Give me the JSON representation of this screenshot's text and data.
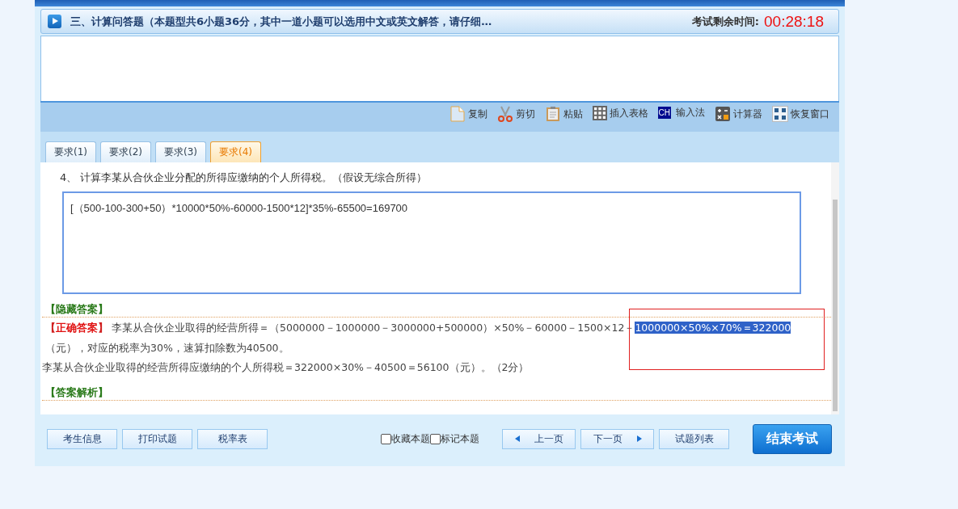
{
  "header": {
    "title": "三、计算问答题（本题型共6小题36分，其中一道小题可以选用中文或英文解答，请仔细…",
    "timer_label": "考试剩余时间:",
    "timer": "00:28:18"
  },
  "toolbar": [
    {
      "kind": "copy",
      "label": "复制"
    },
    {
      "kind": "cut",
      "label": "剪切"
    },
    {
      "kind": "paste",
      "label": "粘贴"
    },
    {
      "kind": "table",
      "label": "插入表格"
    },
    {
      "kind": "ime",
      "label": "输入法",
      "icon_text": "CH"
    },
    {
      "kind": "calc",
      "label": "计算器"
    },
    {
      "kind": "restore",
      "label": "恢复窗口"
    }
  ],
  "tabs": [
    {
      "label": "要求(1)",
      "selected": false
    },
    {
      "label": "要求(2)",
      "selected": false
    },
    {
      "label": "要求(3)",
      "selected": false
    },
    {
      "label": "要求(4)",
      "selected": true
    }
  ],
  "question": "4、 计算李某从合伙企业分配的所得应缴纳的个人所得税。（假设无综合所得）",
  "answer_value": "[（500-100-300+50）*10000*50%-60000-1500*12]*35%-65500=169700",
  "hidden_answer_label": "【隐藏答案】",
  "correct_answer": {
    "label_open": "【",
    "label": "正确答案",
    "label_close": "】",
    "text": " 李某从合伙企业取得的经营所得＝（5000000－1000000－3000000+500000）×50%－60000－1500×12－",
    "selection": "1000000×50%×70%＝322000",
    "text_after": "（元），对应的税率为30%，速算扣除数为40500。"
  },
  "answer_line_2": "李某从合伙企业取得的经营所得应缴纳的个人所得税＝322000×30%－40500＝56100（元）。（2分）",
  "analysis_label": "【答案解析】",
  "footer": {
    "left_buttons": [
      "考生信息",
      "打印试题",
      "税率表"
    ],
    "checkboxes": [
      {
        "label": "收藏本题",
        "checked": false
      },
      {
        "label": "标记本题",
        "checked": false
      }
    ],
    "prev": "上一页",
    "next": "下一页",
    "list": "试题列表",
    "finish": "结束考试"
  }
}
